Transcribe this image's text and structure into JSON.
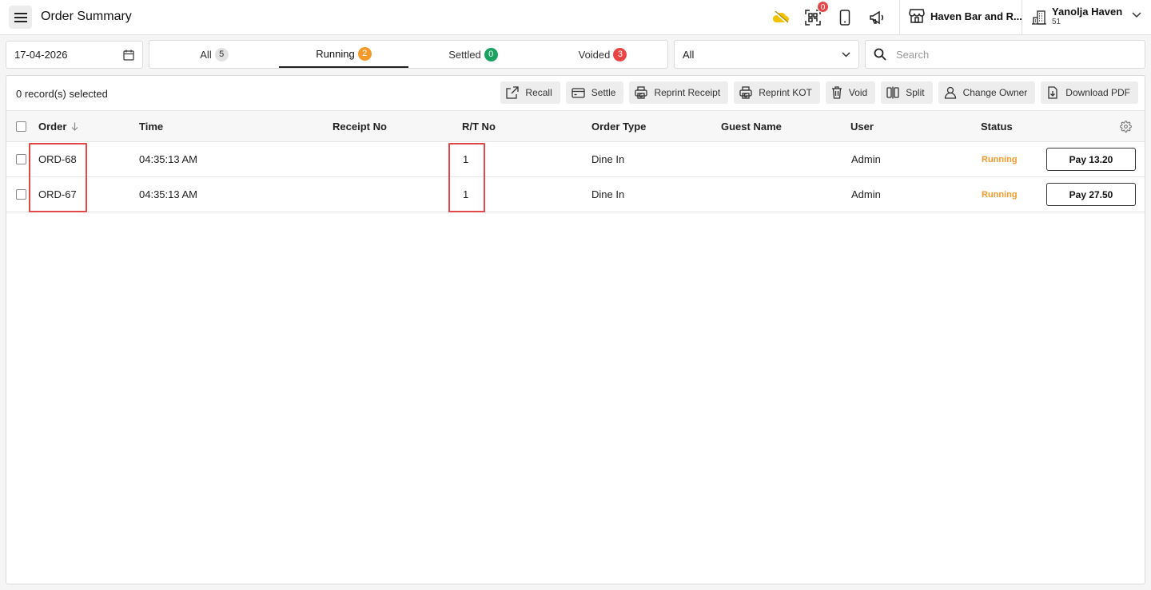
{
  "header": {
    "title": "Order Summary",
    "scan_badge": "0",
    "outlet_name": "Haven Bar and R...",
    "account_name": "Yanolja Haven",
    "account_sub": "51"
  },
  "filters": {
    "date": "17-04-2026",
    "tabs": [
      {
        "label": "All",
        "count": "5",
        "color": "#e2e2e2",
        "text_color": "#333"
      },
      {
        "label": "Running",
        "count": "2",
        "color": "#f39a2a",
        "text_color": "#fff"
      },
      {
        "label": "Settled",
        "count": "0",
        "color": "#1aa260",
        "text_color": "#fff"
      },
      {
        "label": "Voided",
        "count": "3",
        "color": "#e84646",
        "text_color": "#fff"
      }
    ],
    "active_tab": "Running",
    "select_value": "All",
    "search_placeholder": "Search"
  },
  "toolbar": {
    "selected_count": "0 record(s) selected",
    "actions": [
      "Recall",
      "Settle",
      "Reprint Receipt",
      "Reprint KOT",
      "Void",
      "Split",
      "Change Owner",
      "Download PDF"
    ]
  },
  "table": {
    "columns": [
      "Order",
      "Time",
      "Receipt No",
      "R/T No",
      "Order Type",
      "Guest Name",
      "User",
      "Status"
    ],
    "rows": [
      {
        "order": "ORD-68",
        "time": "04:35:13 AM",
        "receipt_no": "",
        "rt_no": "1",
        "order_type": "Dine In",
        "guest_name": "",
        "user": "Admin",
        "status": "Running",
        "pay": "Pay 13.20"
      },
      {
        "order": "ORD-67",
        "time": "04:35:13 AM",
        "receipt_no": "",
        "rt_no": "1",
        "order_type": "Dine In",
        "guest_name": "",
        "user": "Admin",
        "status": "Running",
        "pay": "Pay 27.50"
      }
    ]
  },
  "colors": {
    "running_status": "#f39a2a",
    "highlight": "#e24848",
    "cloud_icon": "#f2c200"
  }
}
